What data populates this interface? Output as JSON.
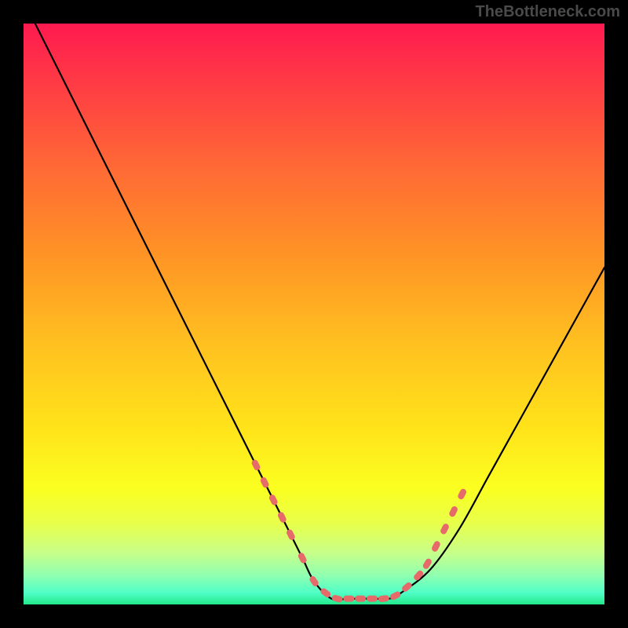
{
  "watermark": "TheBottleneck.com",
  "chart_data": {
    "type": "line",
    "title": "",
    "xlabel": "",
    "ylabel": "",
    "xlim": [
      0,
      100
    ],
    "ylim": [
      0,
      100
    ],
    "series": [
      {
        "name": "bottleneck-curve",
        "x": [
          0,
          5,
          10,
          15,
          20,
          25,
          30,
          35,
          40,
          45,
          48,
          50,
          53,
          56,
          60,
          63,
          65,
          70,
          75,
          80,
          85,
          90,
          95,
          100
        ],
        "values": [
          104,
          94,
          84,
          74,
          64,
          54,
          44,
          34,
          24,
          14,
          8,
          4,
          1,
          1,
          1,
          1,
          2,
          6,
          13,
          22,
          31,
          40,
          49,
          58
        ]
      }
    ],
    "markers": {
      "name": "highlighted-points",
      "color": "#e76a6a",
      "x": [
        40,
        41.5,
        43,
        44.5,
        46,
        48,
        50,
        52,
        54,
        56,
        58,
        60,
        62,
        64,
        66,
        68,
        69.5,
        71,
        72.5,
        74,
        75.5
      ],
      "values": [
        24,
        21,
        18,
        15,
        12,
        8,
        4,
        2,
        1,
        1,
        1,
        1,
        1,
        1.5,
        3,
        5,
        7,
        10,
        13,
        16,
        19
      ]
    },
    "gradient": {
      "top_color": "#ff1a4f",
      "mid_color": "#ffe41a",
      "bottom_color": "#22e88a"
    }
  }
}
